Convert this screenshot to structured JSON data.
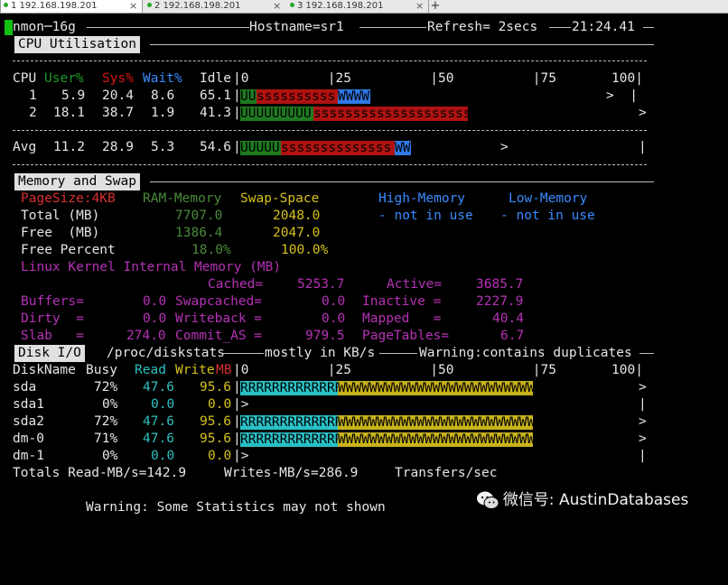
{
  "tabs": [
    {
      "label": "1 192.168.198.201",
      "active": true
    },
    {
      "label": "2 192.168.198.201",
      "active": false
    },
    {
      "label": "3 192.168.198.201",
      "active": false
    }
  ],
  "tab_add": "+",
  "tab_close": "×",
  "header": {
    "left": "nmon─16g",
    "hostname": "Hostname=sr1",
    "refresh": "Refresh= 2secs",
    "time": "21:24.41"
  },
  "cpu": {
    "title": "CPU Utilisation",
    "head": {
      "cpu": "CPU",
      "user": "User%",
      "sys": "Sys%",
      "wait": "Wait%",
      "idle": "Idle",
      "scale": "|0          |25          |50          |75       100|"
    },
    "rows": [
      {
        "cpu": "1",
        "user": "5.9",
        "sys": "20.4",
        "wait": "8.6",
        "idle": "65.1",
        "user_pct": 5.9,
        "sys_pct": 20.4,
        "wait_pct": 8.6,
        "bar_user": "UU",
        "bar_sys": "ssssssssss",
        "bar_wait": "WWWW",
        "tail": ">  |"
      },
      {
        "cpu": "2",
        "user": "18.1",
        "sys": "38.7",
        "wait": "1.9",
        "idle": "41.3",
        "user_pct": 18.1,
        "sys_pct": 38.7,
        "wait_pct": 1.9,
        "bar_user": "UUUUUUUUU",
        "bar_sys": "sssssssssssssssssssss",
        "bar_wait": "",
        "tail": ">"
      }
    ],
    "avg": {
      "label": "Avg",
      "user": "11.2",
      "sys": "28.9",
      "wait": "5.3",
      "idle": "54.6",
      "user_pct": 11.2,
      "sys_pct": 28.9,
      "wait_pct": 5.3,
      "bar_user": "UUUUU",
      "bar_sys": "ssssssssssssss",
      "bar_wait": "WW",
      "mid": ">",
      "tail": "|"
    }
  },
  "mem": {
    "title": "Memory and Swap",
    "head": {
      "pagesize": "PageSize:4KB",
      "ram": "RAM-Memory",
      "swap": "Swap-Space",
      "high": "High-Memory",
      "low": "Low-Memory"
    },
    "total": {
      "label": "Total (MB)",
      "ram": "7707.0",
      "swap": "2048.0",
      "high": "- not in use",
      "low": "- not in use"
    },
    "free": {
      "label": "Free  (MB)",
      "ram": "1386.4",
      "swap": "2047.0"
    },
    "free_pct": {
      "label": "Free Percent",
      "ram": "18.0%",
      "swap": "100.0%"
    },
    "kernel_title": "Linux Kernel Internal Memory (MB)",
    "cached": {
      "label": "Cached=",
      "value": "5253.7",
      "label2": "Active=",
      "value2": "3685.7"
    },
    "buffers": {
      "label": "Buffers=",
      "value": "0.0",
      "label2": "Swapcached=",
      "value2": "0.0",
      "label3": "Inactive =",
      "value3": "2227.9"
    },
    "dirty": {
      "label": "Dirty  =",
      "value": "0.0",
      "label2": "Writeback =",
      "value2": "0.0",
      "label3": "Mapped   =",
      "value3": "40.4"
    },
    "slab": {
      "label": "Slab   =",
      "value": "274.0",
      "label2": "Commit_AS =",
      "value2": "979.5",
      "label3": "PageTables=",
      "value3": "6.7"
    }
  },
  "disk": {
    "title": "Disk I/O",
    "header_info": {
      "path": "/proc/diskstats",
      "units": "mostly in KB/s",
      "warning": "Warning:contains duplicates"
    },
    "head": {
      "name": "DiskName",
      "busy": "Busy",
      "read": "Read",
      "write": "Write",
      "mb": "MB",
      "scale": "|0          |25          |50          |75       100|"
    },
    "rows": [
      {
        "name": "sda",
        "busy": "72%",
        "read": "47.6",
        "write": "95.6",
        "read_mb": 47.6,
        "write_mb": 95.6,
        "bar_r": "RRRRRRRRRRRRR",
        "bar_w": "WWWWWWWWWWWWWWWWWWWWWWWWWW",
        "tail": ">"
      },
      {
        "name": "sda1",
        "busy": "0%",
        "read": "0.0",
        "write": "0.0",
        "read_mb": 0.0,
        "write_mb": 0.0,
        "bar_r": "",
        "bar_w": "",
        "tail": "|"
      },
      {
        "name": "sda2",
        "busy": "72%",
        "read": "47.6",
        "write": "95.6",
        "read_mb": 47.6,
        "write_mb": 95.6,
        "bar_r": "RRRRRRRRRRRRR",
        "bar_w": "WWWWWWWWWWWWWWWWWWWWWWWWWW",
        "tail": ">"
      },
      {
        "name": "dm-0",
        "busy": "71%",
        "read": "47.6",
        "write": "95.6",
        "read_mb": 47.6,
        "write_mb": 95.6,
        "bar_r": "RRRRRRRRRRRRR",
        "bar_w": "WWWWWWWWWWWWWWWWWWWWWWWWWW",
        "tail": ">"
      },
      {
        "name": "dm-1",
        "busy": "0%",
        "read": "0.0",
        "write": "0.0",
        "read_mb": 0.0,
        "write_mb": 0.0,
        "bar_r": "",
        "bar_w": "",
        "tail": "|"
      }
    ],
    "totals": {
      "read": "Totals Read-MB/s=142.9",
      "write": "Writes-MB/s=286.9",
      "transfers": "Transfers/sec"
    }
  },
  "footer": {
    "warning": "Warning: Some Statistics may not shown"
  },
  "watermark": {
    "text": "微信号: AustinDatabases",
    "icon": "wechat-icon"
  },
  "colors": {
    "user": "#1e9b2a",
    "sys": "#d81515",
    "wait": "#3a8cff",
    "read": "#28c0c4",
    "write": "#c8b21a",
    "kernel": "#b532b5"
  }
}
